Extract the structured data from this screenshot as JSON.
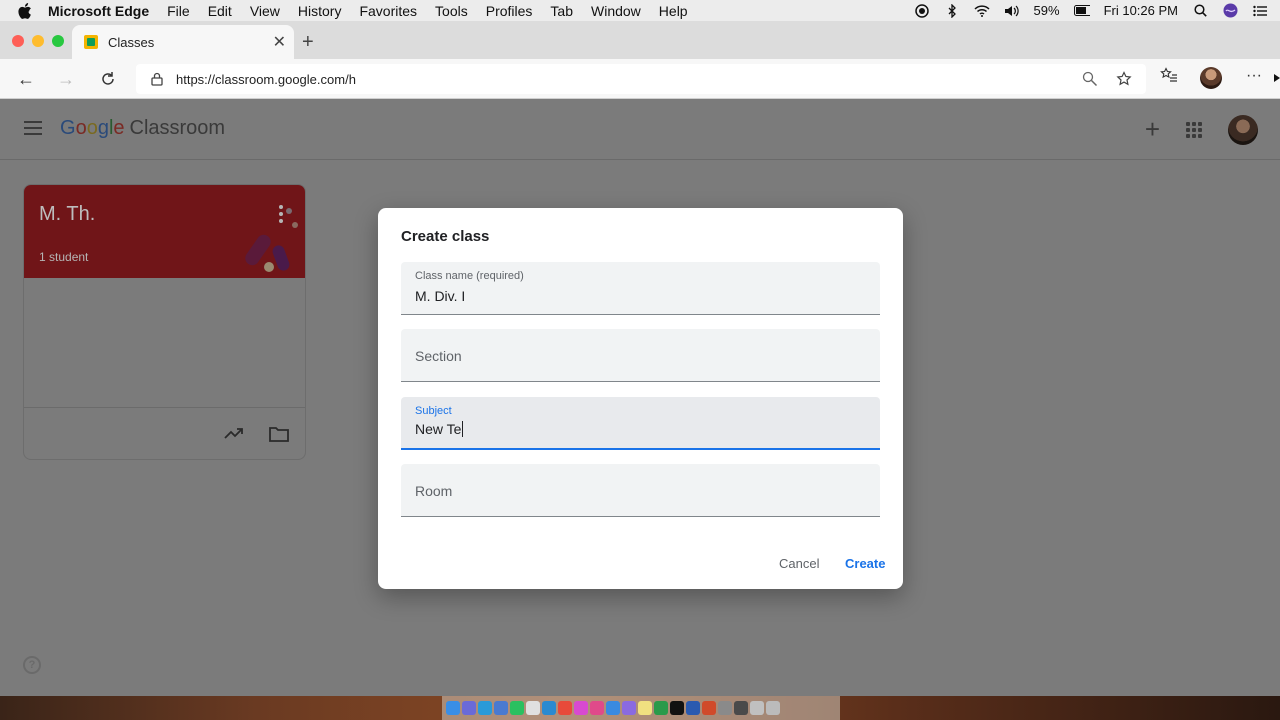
{
  "menubar": {
    "app_name": "Microsoft Edge",
    "menus": [
      "File",
      "Edit",
      "View",
      "History",
      "Favorites",
      "Tools",
      "Profiles",
      "Tab",
      "Window",
      "Help"
    ],
    "battery": "59%",
    "clock": "Fri 10:26 PM"
  },
  "tab": {
    "title": "Classes"
  },
  "address_bar": {
    "url": "https://classroom.google.com/h"
  },
  "header": {
    "logo_letters": [
      "G",
      "o",
      "o",
      "g",
      "l",
      "e"
    ],
    "product": "Classroom"
  },
  "class_card": {
    "title": "M. Th.",
    "students": "1 student",
    "banner_color": "#701518"
  },
  "dialog": {
    "title": "Create class",
    "class_name_label": "Class name (required)",
    "class_name_value": "M. Div. I",
    "section_placeholder": "Section",
    "subject_label": "Subject",
    "subject_value": "New Te",
    "room_placeholder": "Room",
    "cancel_label": "Cancel",
    "create_label": "Create",
    "accent_color": "#1a73e8"
  },
  "help": {
    "icon": "?"
  }
}
